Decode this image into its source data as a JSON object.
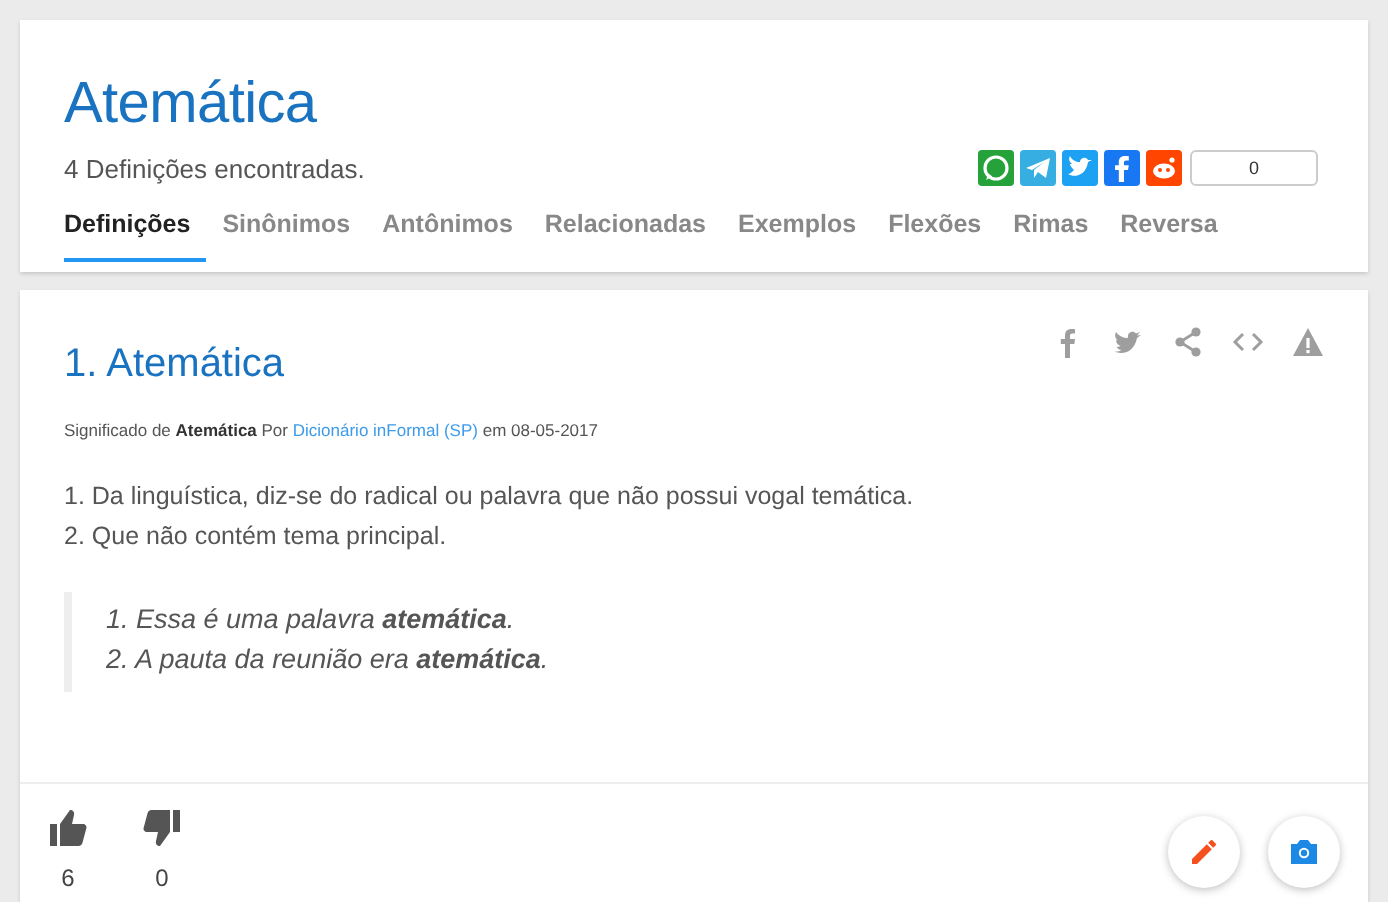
{
  "header": {
    "title": "Atemática",
    "subtitle": "4 Definições encontradas.",
    "share_count": "0"
  },
  "tabs": [
    {
      "label": "Definições",
      "selected": true
    },
    {
      "label": "Sinônimos",
      "selected": false
    },
    {
      "label": "Antônimos",
      "selected": false
    },
    {
      "label": "Relacionadas",
      "selected": false
    },
    {
      "label": "Exemplos",
      "selected": false
    },
    {
      "label": "Flexões",
      "selected": false
    },
    {
      "label": "Rimas",
      "selected": false
    },
    {
      "label": "Reversa",
      "selected": false
    }
  ],
  "definition": {
    "title": "1. Atemática",
    "meta_before": "Significado de **Atemática** Por",
    "author": "Dicionário inFormal (SP)",
    "meta_after": "em 08-05-2017",
    "meanings": [
      "1. Da linguística, diz-se do radical ou palavra que não possui vogal temática.",
      "2. Que não contém tema principal."
    ],
    "examples": [
      "1. Essa é uma palavra **atemática**.",
      "2. A pauta da reunião era **atemática**."
    ],
    "likes": "6",
    "dislikes": "0"
  }
}
